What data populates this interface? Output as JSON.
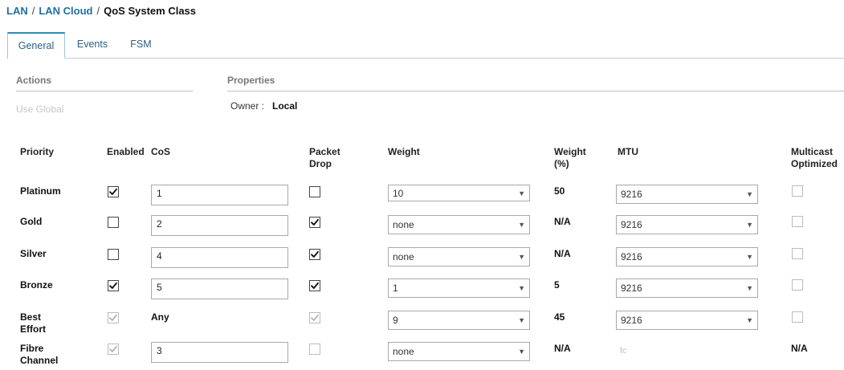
{
  "breadcrumb": {
    "items": [
      "LAN",
      "LAN Cloud",
      "QoS System Class"
    ],
    "separator": "/"
  },
  "tabs": [
    "General",
    "Events",
    "FSM"
  ],
  "active_tab": "General",
  "actions": {
    "title": "Actions",
    "use_global": "Use Global"
  },
  "properties": {
    "title": "Properties",
    "owner_label": "Owner :",
    "owner_value": "Local"
  },
  "table": {
    "headers": {
      "priority": "Priority",
      "enabled": "Enabled",
      "cos": "CoS",
      "packet_drop_1": "Packet",
      "packet_drop_2": "Drop",
      "weight": "Weight",
      "weight_pct_1": "Weight",
      "weight_pct_2": "(%)",
      "mtu": "MTU",
      "multicast_1": "Multicast",
      "multicast_2": "Optimized"
    },
    "rows": [
      {
        "label1": "Platinum",
        "label2": "",
        "enabled": true,
        "enabled_disabled": false,
        "cos": "1",
        "cos_editable": true,
        "packet_drop": false,
        "packet_drop_disabled": false,
        "weight": "10",
        "weight_pct": "50",
        "mtu": "9216",
        "mtu_editable": true,
        "multicast": false,
        "multicast_disabled": true,
        "multicast_text": ""
      },
      {
        "label1": "Gold",
        "label2": "",
        "enabled": false,
        "enabled_disabled": false,
        "cos": "2",
        "cos_editable": true,
        "packet_drop": true,
        "packet_drop_disabled": false,
        "weight": "none",
        "weight_pct": "N/A",
        "mtu": "9216",
        "mtu_editable": true,
        "multicast": false,
        "multicast_disabled": true,
        "multicast_text": ""
      },
      {
        "label1": "Silver",
        "label2": "",
        "enabled": false,
        "enabled_disabled": false,
        "cos": "4",
        "cos_editable": true,
        "packet_drop": true,
        "packet_drop_disabled": false,
        "weight": "none",
        "weight_pct": "N/A",
        "mtu": "9216",
        "mtu_editable": true,
        "multicast": false,
        "multicast_disabled": true,
        "multicast_text": ""
      },
      {
        "label1": "Bronze",
        "label2": "",
        "enabled": true,
        "enabled_disabled": false,
        "cos": "5",
        "cos_editable": true,
        "packet_drop": true,
        "packet_drop_disabled": false,
        "weight": "1",
        "weight_pct": "5",
        "mtu": "9216",
        "mtu_editable": true,
        "multicast": false,
        "multicast_disabled": true,
        "multicast_text": ""
      },
      {
        "label1": "Best",
        "label2": "Effort",
        "enabled": true,
        "enabled_disabled": true,
        "cos": "Any",
        "cos_editable": false,
        "packet_drop": true,
        "packet_drop_disabled": true,
        "weight": "9",
        "weight_pct": "45",
        "mtu": "9216",
        "mtu_editable": true,
        "multicast": false,
        "multicast_disabled": true,
        "multicast_text": ""
      },
      {
        "label1": "Fibre",
        "label2": "Channel",
        "enabled": true,
        "enabled_disabled": true,
        "cos": "3",
        "cos_editable": true,
        "packet_drop": false,
        "packet_drop_disabled": true,
        "weight": "none",
        "weight_pct": "N/A",
        "mtu": "fc",
        "mtu_editable": false,
        "multicast": false,
        "multicast_disabled": true,
        "multicast_text": "N/A"
      }
    ]
  },
  "colors": {
    "link": "#1f6fa3",
    "tab_accent": "#2b8dbb",
    "muted": "#c6c6c6"
  }
}
